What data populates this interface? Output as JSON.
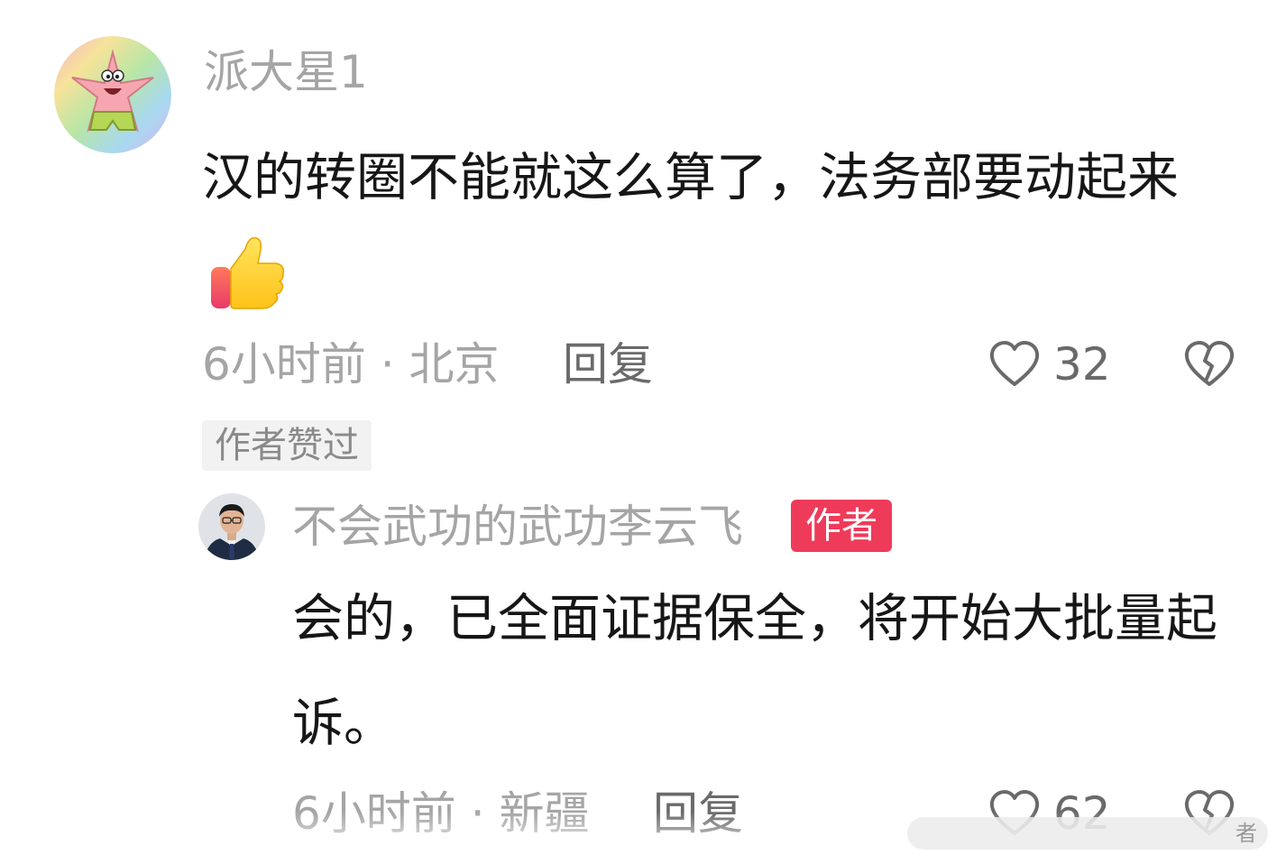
{
  "comment": {
    "username": "派大星1",
    "text": "汉的转圈不能就这么算了，法务部要动起来",
    "emoji": "thumbs-up",
    "meta": "6小时前 · 北京",
    "reply_label": "回复",
    "like_count": "32",
    "author_liked_tag": "作者赞过"
  },
  "reply": {
    "username": "不会武功的武功李云飞",
    "badge": "作者",
    "text": "会的，已全面证据保全，将开始大批量起诉。",
    "meta": "6小时前 · 新疆",
    "reply_label": "回复",
    "like_count": "62"
  },
  "watermark": {
    "text": "者"
  },
  "icons": {
    "like": "heart-outline-icon",
    "dislike": "broken-heart-outline-icon"
  },
  "colors": {
    "badge": "#ef3b5a",
    "secondary_text": "#a5a5a5",
    "primary_text": "#161616"
  }
}
